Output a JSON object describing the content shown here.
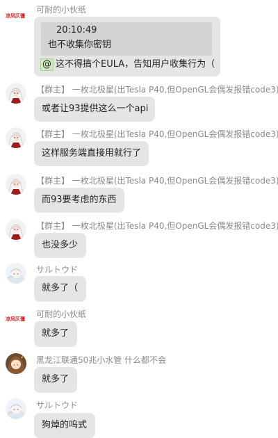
{
  "messages": [
    {
      "sender": "可耐的小伙纸",
      "avatar_icon": "red-calligraphy-logo",
      "avatar_text": "凉凤仄僵",
      "quote": {
        "time": "20:10:49",
        "text": "也不收集你密钥"
      },
      "mention_symbol": "@",
      "text": "这不得搞个EULA，告知用户收集行为（"
    },
    {
      "role": "【群主】",
      "sender": "一枚北极星(出Tesla P40,但OpenGL会偶发报错code3)",
      "avatar_icon": "anime-girl-avatar",
      "text": "或者让93提供这么一个api"
    },
    {
      "role": "【群主】",
      "sender": "一枚北极星(出Tesla P40,但OpenGL会偶发报错code3)",
      "avatar_icon": "anime-girl-avatar",
      "text": "这样服务端直接用就行了"
    },
    {
      "role": "【群主】",
      "sender": "一枚北极星(出Tesla P40,但OpenGL会偶发报错code3)",
      "avatar_icon": "anime-girl-avatar",
      "text": "而93要考虑的东西"
    },
    {
      "role": "【群主】",
      "sender": "一枚北极星(出Tesla P40,但OpenGL会偶发报错code3)",
      "avatar_icon": "anime-girl-avatar",
      "text": "也没多少"
    },
    {
      "sender": "サルトウド",
      "avatar_icon": "anime-avatar-blue",
      "text": "就多了（"
    },
    {
      "sender": "可耐的小伙纸",
      "avatar_icon": "red-calligraphy-logo",
      "avatar_text": "凉凤仄僵",
      "text": "就多了"
    },
    {
      "sender": "黑龙江联通50兆小水管 什么都不会",
      "avatar_icon": "anime-avatar-orange",
      "text": "就多了"
    },
    {
      "sender": "サルトウド",
      "avatar_icon": "anime-avatar-blue",
      "text": "狗焯的呜式"
    }
  ],
  "colors": {
    "bubble": "#e5e5e5",
    "quote": "#d3d3d3",
    "sender": "#8a8a8a",
    "logo_red": "#d42020",
    "mention_bg": "#cfe8c2"
  }
}
